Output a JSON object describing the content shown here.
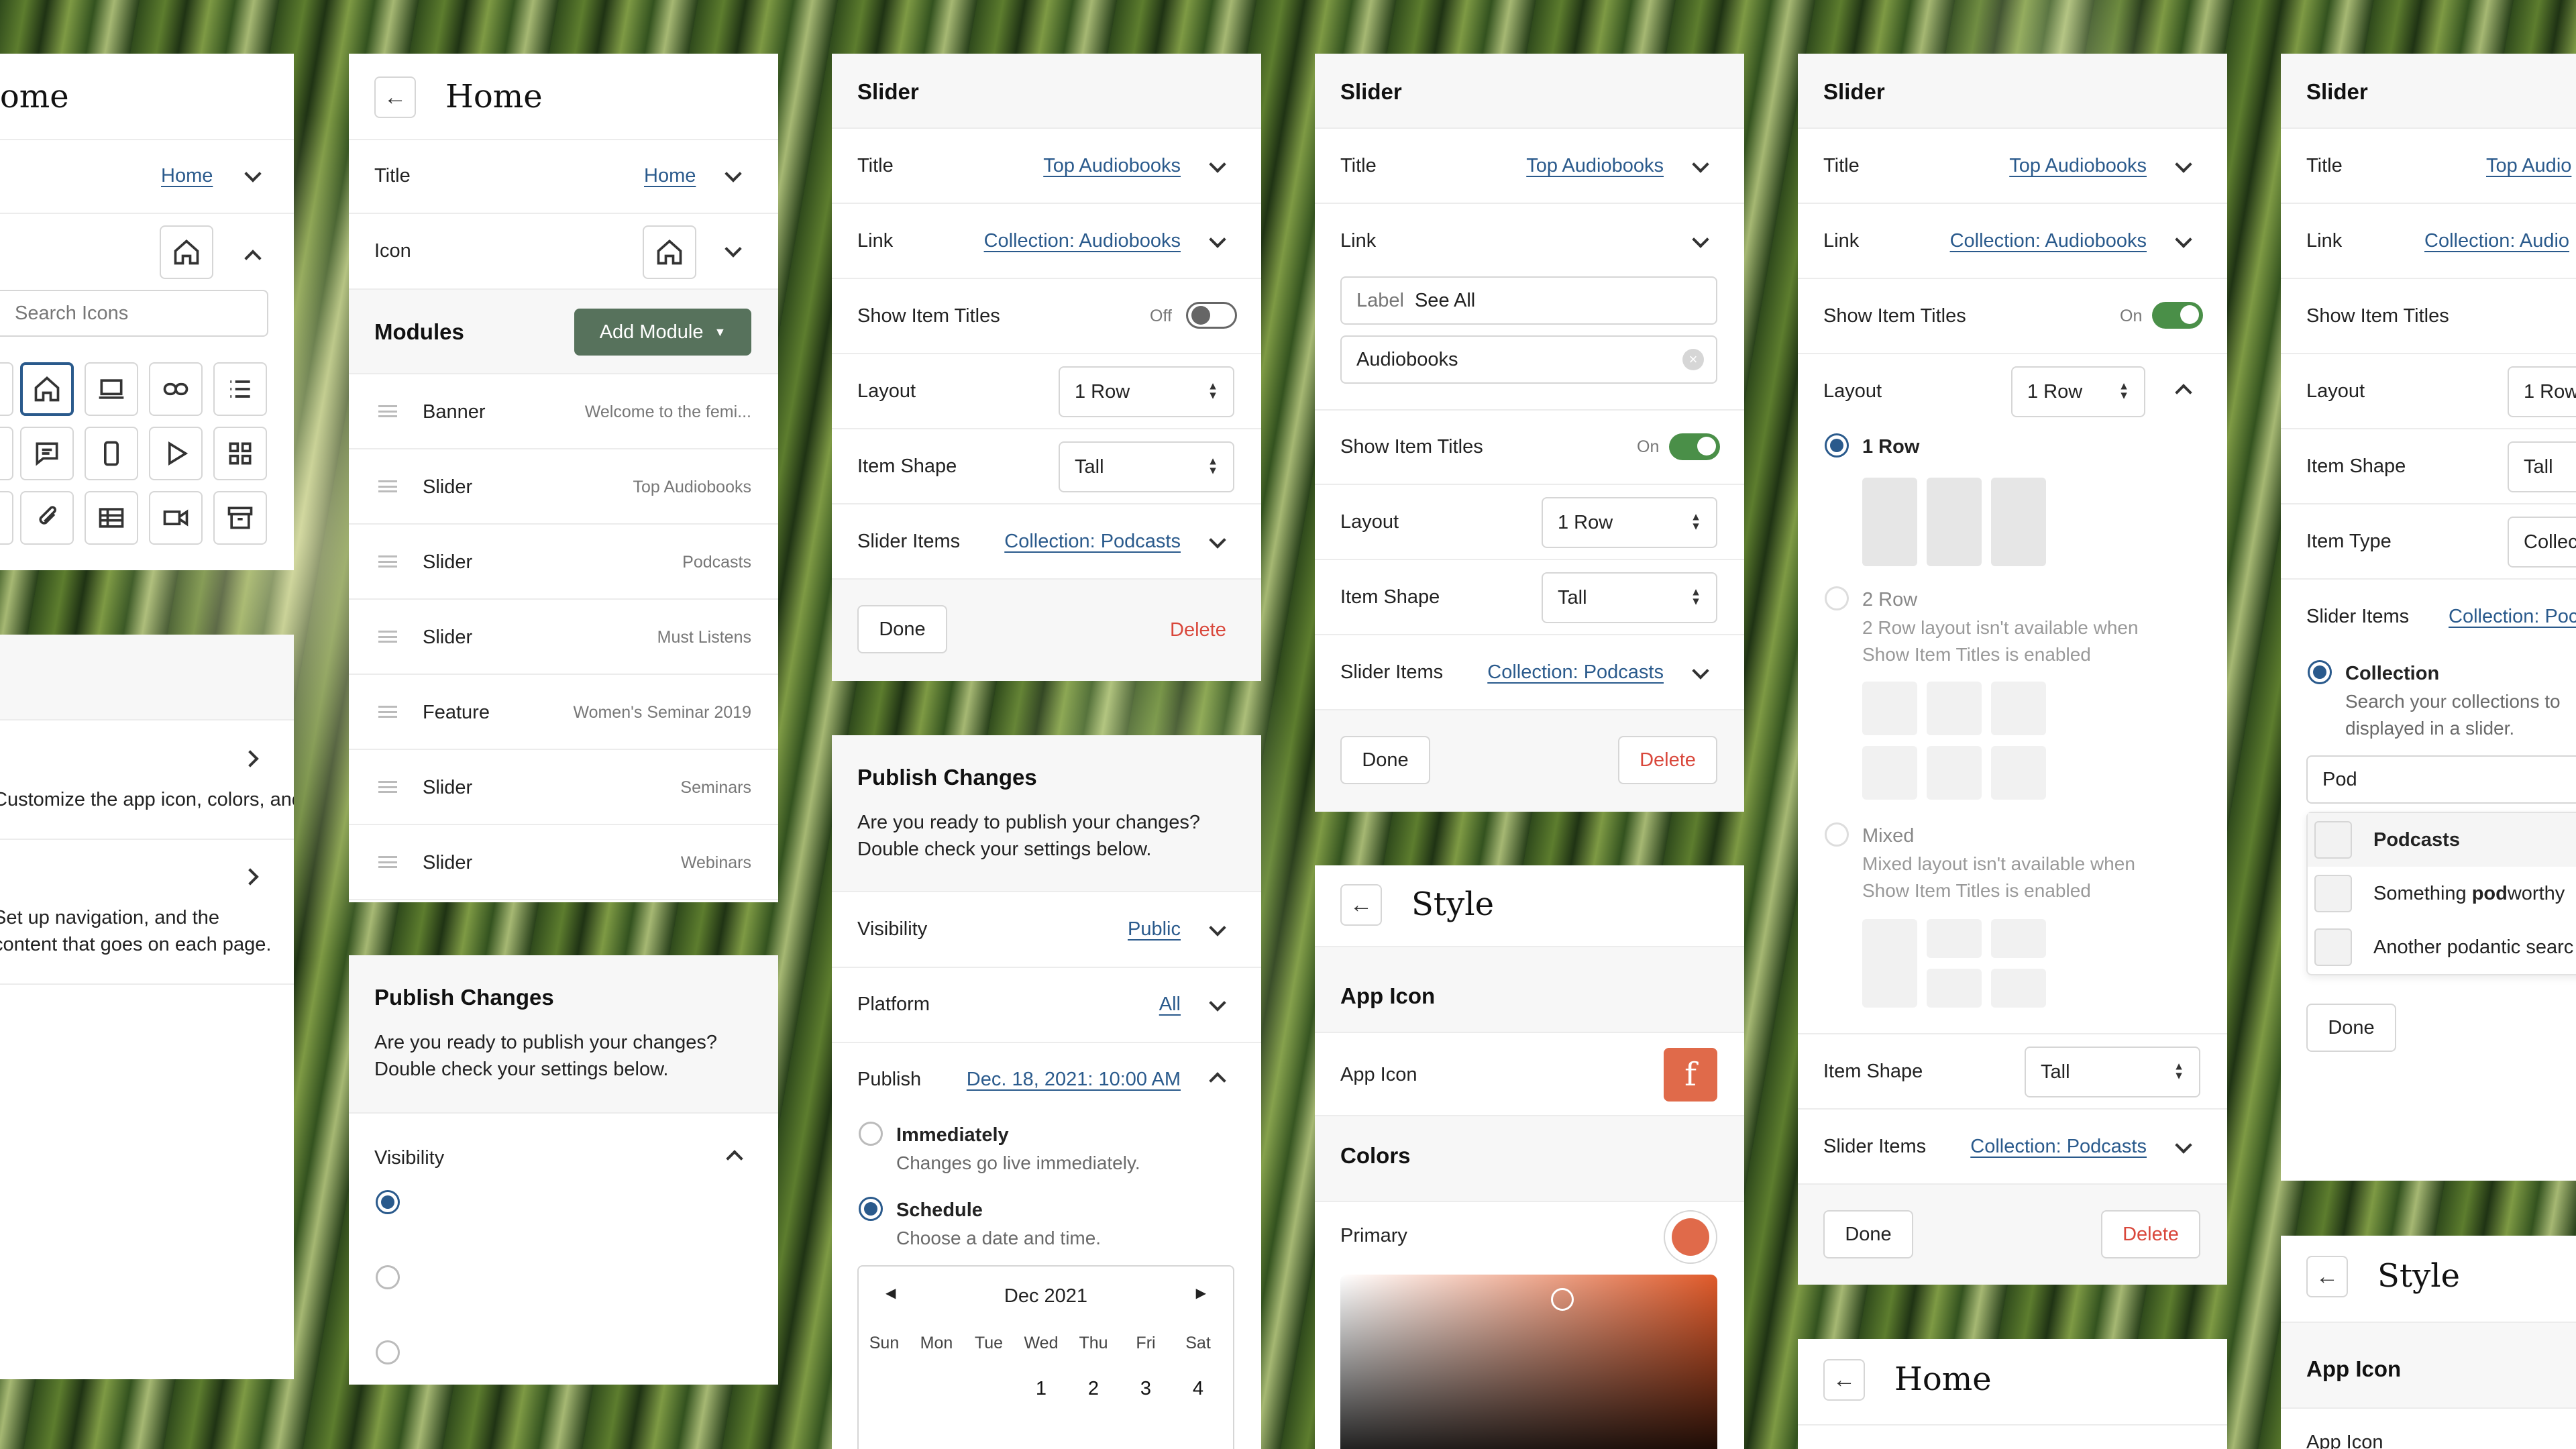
{
  "p1": {
    "title": "Home",
    "title_value": "Home",
    "search_placeholder": "Search Icons"
  },
  "p2": {
    "title": "Home",
    "title_label": "Title",
    "title_value": "Home",
    "icon_label": "Icon",
    "modules_label": "Modules",
    "add_module": "Add Module",
    "modules": [
      {
        "type": "Banner",
        "value": "Welcome to the femi..."
      },
      {
        "type": "Slider",
        "value": "Top Audiobooks"
      },
      {
        "type": "Slider",
        "value": "Podcasts"
      },
      {
        "type": "Slider",
        "value": "Must Listens"
      },
      {
        "type": "Feature",
        "value": "Women's Seminar 2019"
      },
      {
        "type": "Slider",
        "value": "Seminars"
      },
      {
        "type": "Slider",
        "value": "Webinars"
      }
    ]
  },
  "p3": {
    "header": "Slider",
    "title_label": "Title",
    "title_value": "Top Audiobooks",
    "link_label": "Link",
    "link_value": "Collection: Audiobooks",
    "sit_label": "Show Item Titles",
    "sit_state": "Off",
    "layout_label": "Layout",
    "layout_value": "1 Row",
    "shape_label": "Item Shape",
    "shape_value": "Tall",
    "items_label": "Slider Items",
    "items_value": "Collection: Podcasts",
    "done": "Done",
    "delete": "Delete"
  },
  "p4": {
    "header": "Publish Changes",
    "desc1": "Are you ready to publish your changes?",
    "desc2": "Double check your settings below.",
    "vis_label": "Visibility",
    "vis_value": "Public",
    "plat_label": "Platform",
    "plat_value": "All",
    "pub_label": "Publish",
    "pub_value": "Dec. 18, 2021: 10:00 AM",
    "opt1": "Immediately",
    "opt1_desc": "Changes go live immediately.",
    "opt2": "Schedule",
    "opt2_desc": "Choose a date and time.",
    "month": "Dec 2021",
    "days": [
      "Sun",
      "Mon",
      "Tue",
      "Wed",
      "Thu",
      "Fri",
      "Sat"
    ],
    "nums": [
      "1",
      "2",
      "3",
      "4"
    ]
  },
  "p5": {
    "header": "Slider",
    "title_label": "Title",
    "title_value": "Top Audiobooks",
    "link_label": "Link",
    "link_sub_label": "Label",
    "link_sub_value": "See All",
    "link_input": "Audiobooks",
    "sit_label": "Show Item Titles",
    "sit_state": "On",
    "layout_label": "Layout",
    "layout_value": "1 Row",
    "shape_label": "Item Shape",
    "shape_value": "Tall",
    "items_label": "Slider Items",
    "items_value": "Collection: Podcasts",
    "done": "Done",
    "delete": "Delete"
  },
  "p6": {
    "title": "Style",
    "app_icon_h": "App Icon",
    "app_icon_label": "App Icon",
    "app_icon_letter": "f",
    "colors_h": "Colors",
    "primary_label": "Primary",
    "primary_color": "#e06a4a"
  },
  "p7": {
    "header": "Slider",
    "title_label": "Title",
    "title_value": "Top Audiobooks",
    "link_label": "Link",
    "link_value": "Collection: Audiobooks",
    "sit_label": "Show Item Titles",
    "sit_state": "On",
    "layout_label": "Layout",
    "layout_value": "1 Row",
    "opt1": "1 Row",
    "opt2": "2 Row",
    "opt2_d1": "2 Row layout isn't available when",
    "opt2_d2": "Show Item Titles is enabled",
    "opt3": "Mixed",
    "opt3_d1": "Mixed layout isn't available when",
    "opt3_d2": "Show Item Titles is enabled",
    "shape_label": "Item Shape",
    "shape_value": "Tall",
    "items_label": "Slider Items",
    "items_value": "Collection: Podcasts",
    "done": "Done",
    "delete": "Delete"
  },
  "p8": {
    "title": "Home"
  },
  "p9": {
    "header": "Slider",
    "title_label": "Title",
    "title_value": "Top Audio",
    "link_label": "Link",
    "link_value": "Collection: Audio",
    "sit_label": "Show Item Titles",
    "layout_label": "Layout",
    "layout_value": "1 Row",
    "shape_label": "Item Shape",
    "shape_value": "Tall",
    "type_label": "Item Type",
    "type_value": "Collec",
    "items_label": "Slider Items",
    "items_value": "Collection: Poc",
    "coll_label": "Collection",
    "coll_d1": "Search your collections to",
    "coll_d2": "displayed in a slider.",
    "search_value": "Pod",
    "res1": "Podcasts",
    "res2a": "Something ",
    "res2b": "pod",
    "res2c": "worthy",
    "res3": "Another podantic searc",
    "done": "Done"
  },
  "p10": {
    "title": "Style",
    "app_icon_h": "App Icon",
    "app_icon_label": "App Icon"
  },
  "p1b": {
    "row1": "Customize the app icon, colors, and fonts.",
    "row2a": "Set up navigation, and the",
    "row2b": "content that goes on each page."
  }
}
